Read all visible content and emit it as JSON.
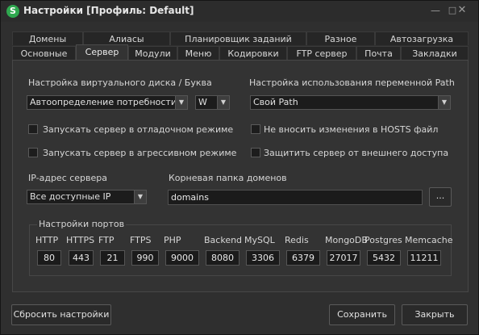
{
  "window": {
    "title": "Настройки [Профиль: Default]",
    "app_icon_letter": "S",
    "minimize": "—",
    "maximize": "□",
    "close": "✕"
  },
  "tabs": {
    "row1": [
      "Домены",
      "Алиасы",
      "Планировщик заданий",
      "Разное",
      "Автозагрузка"
    ],
    "row2": [
      "Основные",
      "Сервер",
      "Модули",
      "Меню",
      "Кодировки",
      "FTP сервер",
      "Почта",
      "Закладки"
    ],
    "active": "Сервер"
  },
  "server": {
    "vdisk_label": "Настройка виртуального диска / Буква",
    "vdisk_mode": "Автоопределение потребности",
    "vdisk_letter": "W",
    "path_label": "Настройка использования переменной Path",
    "path_value": "Свой Path",
    "debug_mode": "Запускать сервер в отладочном режиме",
    "aggressive_mode": "Запускать сервер в агрессивном режиме",
    "no_hosts": "Не вносить изменения в HOSTS файл",
    "protect_external": "Защитить сервер от внешнего доступа",
    "ip_label": "IP-адрес сервера",
    "ip_value": "Все доступные IP",
    "root_label": "Корневая папка доменов",
    "root_value": "domains",
    "browse": "..."
  },
  "ports": {
    "title": "Настройки портов",
    "items": [
      {
        "name": "HTTP",
        "value": "80"
      },
      {
        "name": "HTTPS",
        "value": "443"
      },
      {
        "name": "FTP",
        "value": "21"
      },
      {
        "name": "FTPS",
        "value": "990"
      },
      {
        "name": "PHP",
        "value": "9000"
      },
      {
        "name": "Backend",
        "value": "8080"
      },
      {
        "name": "MySQL",
        "value": "3306"
      },
      {
        "name": "Redis",
        "value": "6379"
      },
      {
        "name": "MongoDB",
        "value": "27017"
      },
      {
        "name": "Postgres",
        "value": "5432"
      },
      {
        "name": "Memcache",
        "value": "11211"
      }
    ]
  },
  "footer": {
    "reset": "Сбросить настройки",
    "save": "Сохранить",
    "close": "Закрыть"
  }
}
